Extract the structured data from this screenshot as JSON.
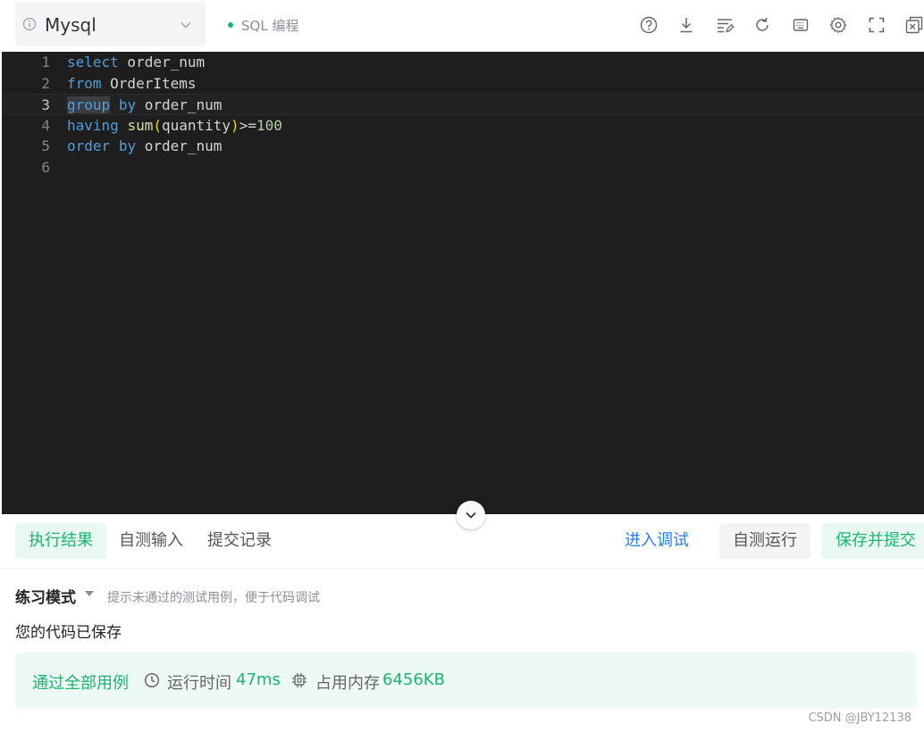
{
  "topbar": {
    "language": "Mysql",
    "mode_tag": "SQL 编程",
    "tool_icons": [
      "help-icon",
      "download-icon",
      "format-icon",
      "reset-icon",
      "keyboard-icon",
      "settings-icon",
      "fullscreen-icon",
      "popout-icon"
    ]
  },
  "editor": {
    "lines": [
      {
        "num": "1",
        "tokens": [
          {
            "t": "select",
            "c": "kw"
          },
          {
            "t": " order_num",
            "c": ""
          }
        ]
      },
      {
        "num": "2",
        "tokens": [
          {
            "t": "from",
            "c": "kw"
          },
          {
            "t": " OrderItems",
            "c": ""
          }
        ]
      },
      {
        "num": "3",
        "tokens": [
          {
            "t": "group",
            "c": "kw selkw"
          },
          {
            "t": " ",
            "c": ""
          },
          {
            "t": "by",
            "c": "kw"
          },
          {
            "t": " order_num",
            "c": ""
          }
        ]
      },
      {
        "num": "4",
        "tokens": [
          {
            "t": "having",
            "c": "kw"
          },
          {
            "t": " ",
            "c": ""
          },
          {
            "t": "sum",
            "c": "fn"
          },
          {
            "t": "(",
            "c": "paren"
          },
          {
            "t": "quantity",
            "c": ""
          },
          {
            "t": ")",
            "c": "paren"
          },
          {
            "t": ">=",
            "c": ""
          },
          {
            "t": "100",
            "c": "num"
          }
        ]
      },
      {
        "num": "5",
        "tokens": [
          {
            "t": "order",
            "c": "kw"
          },
          {
            "t": " ",
            "c": ""
          },
          {
            "t": "by",
            "c": "kw"
          },
          {
            "t": " order_num",
            "c": ""
          }
        ]
      },
      {
        "num": "6",
        "tokens": []
      }
    ],
    "active_line": 3
  },
  "tabs": {
    "items": [
      "执行结果",
      "自测输入",
      "提交记录"
    ],
    "active": 0,
    "debug_label": "进入调试",
    "run_label": "自测运行",
    "submit_label": "保存并提交"
  },
  "result": {
    "mode_title": "练习模式",
    "mode_hint": "提示未通过的测试用例，便于代码调试",
    "saved_message": "您的代码已保存",
    "pass_text": "通过全部用例",
    "runtime_label": "运行时间",
    "runtime_value": "47ms",
    "memory_label": "占用内存",
    "memory_value": "6456KB"
  },
  "watermark": "CSDN @JBY12138",
  "colors": {
    "accent_green": "#1bb56f",
    "link_blue": "#2b7de9",
    "editor_bg": "#1e1e1e"
  }
}
